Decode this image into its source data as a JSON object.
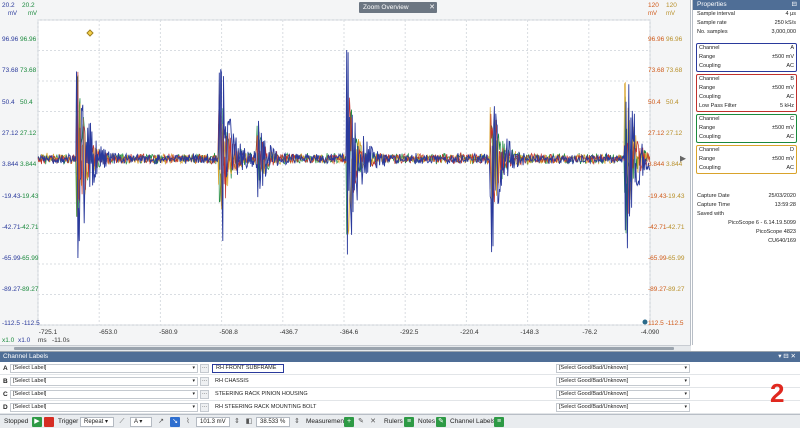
{
  "scope": {
    "zoom_overview_title": "Zoom Overview",
    "top_left_a": "20.2",
    "top_left_b": "20.2",
    "top_units_left": [
      "mV",
      "mV"
    ],
    "top_right_c": "120",
    "top_right_d": "120",
    "top_units_right": [
      "mV",
      "mV"
    ],
    "y_ticks_left": [
      {
        "a": "96.96",
        "b": "96.96"
      },
      {
        "a": "73.68",
        "b": "73.68"
      },
      {
        "a": "50.4",
        "b": "50.4"
      },
      {
        "a": "27.12",
        "b": "27.12"
      },
      {
        "a": "3.844",
        "b": "3.844"
      },
      {
        "a": "-19.43",
        "b": "-19.43"
      },
      {
        "a": "-42.71",
        "b": "-42.71"
      },
      {
        "a": "-65.99",
        "b": "-65.99"
      },
      {
        "a": "-89.27",
        "b": "-89.27"
      }
    ],
    "y_ticks_right": [
      {
        "c": "96.96",
        "d": "96.96"
      },
      {
        "c": "73.68",
        "d": "73.68"
      },
      {
        "c": "50.4",
        "d": "50.4"
      },
      {
        "c": "27.12",
        "d": "27.12"
      },
      {
        "c": "3.844",
        "d": "3.844"
      },
      {
        "c": "-19.43",
        "d": "-19.43"
      },
      {
        "c": "-42.71",
        "d": "-42.71"
      },
      {
        "c": "-65.99",
        "d": "-65.99"
      },
      {
        "c": "-89.27",
        "d": "-89.27"
      }
    ],
    "bottom_left": "-112.5 -112.5",
    "bottom_right": "112.5 -112.5",
    "x_ticks": [
      "-725.1",
      "-653.0",
      "-580.9",
      "-508.8",
      "-436.7",
      "-364.6",
      "-292.5",
      "-220.4",
      "-148.3",
      "-76.2",
      "-4.090"
    ],
    "x_unit": "ms",
    "x_offset": "-11.0s",
    "x_scale_left": "x1.0",
    "x_scale_right": "x1.0"
  },
  "properties": {
    "title": "Properties",
    "general": [
      {
        "k": "Sample interval",
        "v": "4 μs"
      },
      {
        "k": "Sample rate",
        "v": "250 kS/s"
      },
      {
        "k": "No. samples",
        "v": "3,000,000"
      }
    ],
    "channels": [
      {
        "id": "a",
        "rows": [
          {
            "k": "Channel",
            "v": "A"
          },
          {
            "k": "Range",
            "v": "±500 mV"
          },
          {
            "k": "Coupling",
            "v": "AC"
          }
        ]
      },
      {
        "id": "b",
        "rows": [
          {
            "k": "Channel",
            "v": "B"
          },
          {
            "k": "Range",
            "v": "±500 mV"
          },
          {
            "k": "Coupling",
            "v": "AC"
          },
          {
            "k": "Low Pass Filter",
            "v": "5 kHz"
          }
        ]
      },
      {
        "id": "c",
        "rows": [
          {
            "k": "Channel",
            "v": "C"
          },
          {
            "k": "Range",
            "v": "±500 mV"
          },
          {
            "k": "Coupling",
            "v": "AC"
          }
        ]
      },
      {
        "id": "d",
        "rows": [
          {
            "k": "Channel",
            "v": "D"
          },
          {
            "k": "Range",
            "v": "±500 mV"
          },
          {
            "k": "Coupling",
            "v": "AC"
          }
        ]
      }
    ],
    "capture_date_label": "Capture Date",
    "capture_date": "25/03/2020",
    "capture_time_label": "Capture Time",
    "capture_time": "13:59:28",
    "saved_with_label": "Saved with",
    "saved_with": [
      "PicoScope 6 - 6.14.19.5099",
      "PicoScope 4823",
      "CU640/169"
    ]
  },
  "channel_labels": {
    "title": "Channel Labels",
    "rows": [
      {
        "letter": "A",
        "select": "[Select Label]",
        "note": "RH FRONT SUBFRAME",
        "status": "[Select Good/Bad/Unknown]"
      },
      {
        "letter": "B",
        "select": "[Select Label]",
        "note": "RH CHASSIS",
        "status": "[Select Good/Bad/Unknown]"
      },
      {
        "letter": "C",
        "select": "[Select Label]",
        "note": "STEERING RACK PINION HOUSING",
        "status": "[Select Good/Bad/Unknown]"
      },
      {
        "letter": "D",
        "select": "[Select Label]",
        "note": "RH STEERING RACK MOUNTING BOLT",
        "status": "[Select Good/Bad/Unknown]"
      }
    ],
    "annotation_number": "2"
  },
  "toolbar": {
    "status": "Stopped",
    "trigger_label": "Trigger",
    "trigger_mode": "Repeat",
    "trigger_channel": "A",
    "trigger_level": "101.3 mV",
    "zoom": "38.533 %",
    "measurements": "Measurements",
    "rulers": "Rulers",
    "notes": "Notes",
    "channel_labels": "Channel Labels"
  },
  "colors": {
    "channel_a": "#2a3a9c",
    "channel_b": "#c0312c",
    "channel_c": "#1b8a3d",
    "channel_d": "#d9a32b",
    "panel_header": "#4f6e96"
  }
}
